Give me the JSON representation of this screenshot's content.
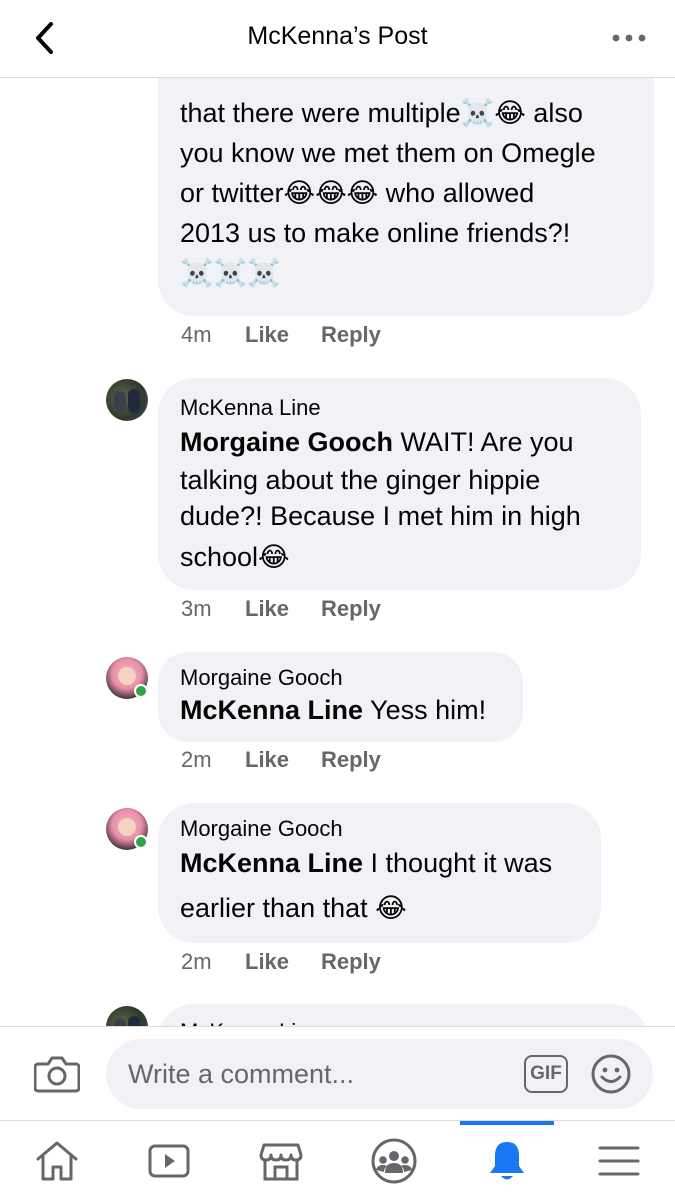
{
  "header": {
    "title": "McKenna’s Post"
  },
  "comments": [
    {
      "id": "c1",
      "author": "",
      "lines": [
        "that there were multiple☠️😂 also",
        "you know we met them on Omegle",
        "or twitter😂😂😂 who allowed",
        "2013 us to make online friends?!",
        "☠️☠️☠️"
      ],
      "time": "4m",
      "like": "Like",
      "reply": "Reply"
    },
    {
      "id": "c2",
      "author": "McKenna Line",
      "tag": "Morgaine Gooch",
      "lines": [
        " WAIT! Are you",
        "talking about the ginger hippie",
        "dude?!  Because I met him in high",
        "school😂"
      ],
      "time": "3m",
      "like": "Like",
      "reply": "Reply"
    },
    {
      "id": "c3",
      "author": "Morgaine Gooch",
      "tag": "McKenna Line",
      "lines": [
        " Yess him!"
      ],
      "time": "2m",
      "like": "Like",
      "reply": "Reply"
    },
    {
      "id": "c4",
      "author": "Morgaine Gooch",
      "tag": "McKenna Line",
      "lines": [
        " I thought it was",
        "earlier than that 😂"
      ],
      "time": "2m",
      "like": "Like",
      "reply": "Reply"
    },
    {
      "id": "c5",
      "author": "McKenna Line"
    }
  ],
  "composer": {
    "placeholder": "Write a comment...",
    "gif_label": "GIF"
  },
  "tabbar": {
    "items": [
      "home-icon",
      "watch-icon",
      "marketplace-icon",
      "groups-icon",
      "notifications-icon",
      "menu-icon"
    ],
    "active": "notifications-icon"
  },
  "colors": {
    "accent": "#1877f2",
    "bubble": "#f0f2f5",
    "meta": "#65676b",
    "online": "#31a24c"
  }
}
